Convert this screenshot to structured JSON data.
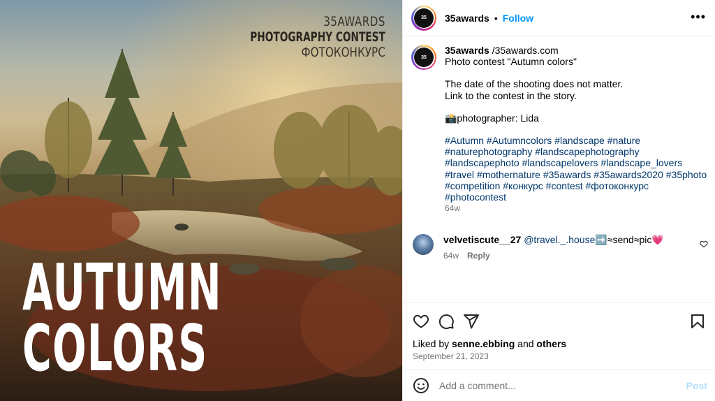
{
  "image": {
    "brand_line1": "35AWARDS",
    "brand_line2": "PHOTOGRAPHY CONTEST",
    "brand_line3": "ФОТОКОНКУРС",
    "headline_line1": "AUTUMN",
    "headline_line2": "COLORS"
  },
  "header": {
    "username": "35awards",
    "dot": "•",
    "follow_label": "Follow",
    "more_label": "•••"
  },
  "caption": {
    "username": "35awards",
    "first_line_rest": " /35awards.com",
    "line2": "Photo contest \"Autumn colors\"",
    "line3": "The date of the shooting does not matter.",
    "line4": "Link to the contest in the story.",
    "line5": "📸photographer: Lida",
    "hashtags": "#Autumn #Autumncolors #landscape #nature #naturephotography #landscapephotography #landscapephoto #landscapelovers #landscape_lovers #travel #mothernature #35awards #35awards2020 #35photo #competition #конкурс #contest #фотоконкурс #photocontest",
    "time": "64w"
  },
  "comment": {
    "username": "velvetiscute__27",
    "mention": "@travel._.house",
    "text_rest": "➡️≈send≈pic💗",
    "time": "64w",
    "reply_label": "Reply"
  },
  "actions": {
    "liked_by_prefix": "Liked by ",
    "liked_by_user": "senne.ebbing",
    "liked_by_mid": " and ",
    "liked_by_others": "others",
    "date": "September 21, 2023"
  },
  "comment_bar": {
    "placeholder": "Add a comment...",
    "post_label": "Post"
  },
  "colors": {
    "accent": "#0095f6",
    "hashtag": "#00376b",
    "muted": "#737373",
    "post_disabled": "#b2dffc"
  }
}
